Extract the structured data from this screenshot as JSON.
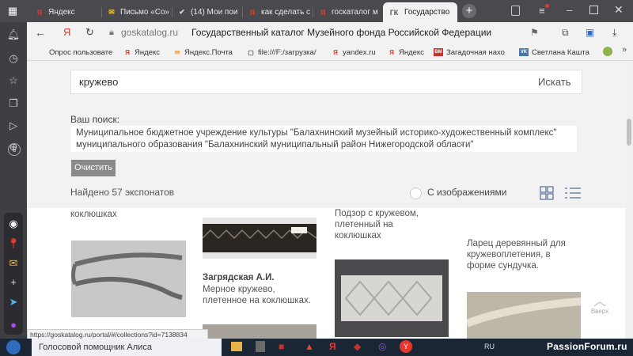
{
  "tabs": [
    {
      "label": "Яндекс",
      "icon": "Я"
    },
    {
      "label": "Письмо «Со»",
      "icon": "✉"
    },
    {
      "label": "(14) Мои пои",
      "icon": "✔"
    },
    {
      "label": "как сделать с",
      "icon": "Я"
    },
    {
      "label": "госкаталог м",
      "icon": "Я"
    },
    {
      "label": "Государство",
      "icon": "ГК"
    }
  ],
  "address": {
    "domain": "goskatalog.ru",
    "title": "Государственный каталог Музейного фонда Российской Федерации"
  },
  "bookmarks": [
    {
      "label": "Опрос пользовате",
      "icon": ""
    },
    {
      "label": "Яндекс",
      "icon": "Я"
    },
    {
      "label": "Яндекс.Почта",
      "icon": "✉"
    },
    {
      "label": "file:///F:/загрузка/",
      "icon": "▢"
    },
    {
      "label": "yandex.ru",
      "icon": "Я"
    },
    {
      "label": "Яндекс",
      "icon": "Я"
    },
    {
      "label": "Загадочная нахо",
      "icon": "ВМ"
    },
    {
      "label": "Светлана Кашта",
      "icon": "VK"
    }
  ],
  "search": {
    "query": "кружево",
    "button": "Искать",
    "your_search_label": "Ваш поиск:",
    "filter_line1": "Муниципальное бюджетное учреждение культуры \"Балахнинский музейный историко-художественный комплекс\"",
    "filter_line2": "муниципального образования \"Балахнинский муниципальный район Нижегородской области\"",
    "filter_remove": "×",
    "clear_button": "Очистить",
    "found": "Найдено 57 экспонатов",
    "with_images": "С изображениями"
  },
  "results": {
    "col1_title": "коклюшках",
    "col2_author": "Загрядская А.И.",
    "col2_text_1": "Мерное кружево,",
    "col2_text_2": "плетенное на коклюшках.",
    "col3_title_1": "Подзор с кружевом,",
    "col3_title_2": "плетенный на",
    "col3_title_3": "коклюшках",
    "col4_title_1": "Ларец деревянный для",
    "col4_title_2": "кружевоплетения, в",
    "col4_title_3": "форме сундучка.",
    "up_label": "Вверх"
  },
  "status_url": "https://goskatalog.ru/portal/#/collections?id=7138834",
  "taskbar": {
    "alice": "Голосовой помощник Алиса",
    "lang": "RU",
    "watermark": "PassionForum.ru"
  },
  "colors": {
    "accent": "#6a7fa3",
    "yandex_red": "#e8372c",
    "clear_btn": "#8a8a8a"
  }
}
